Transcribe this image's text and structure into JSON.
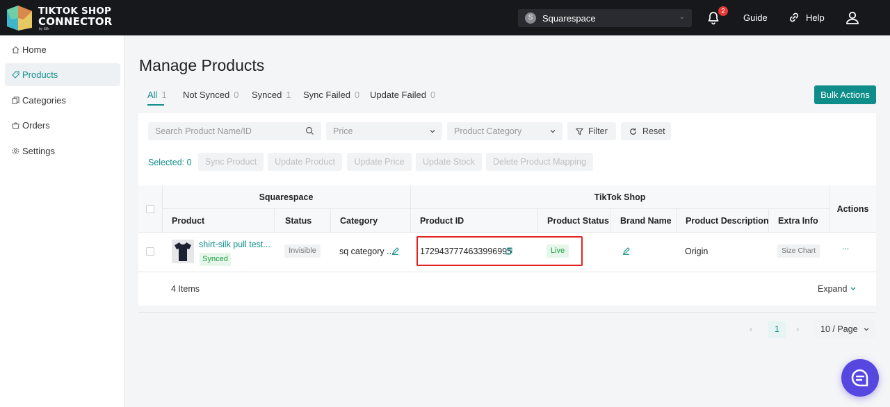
{
  "brand": {
    "line1": "TIKTOK SHOP",
    "line2": "CONNECTOR",
    "by": "by Silk"
  },
  "header": {
    "store": {
      "avatar": "S",
      "name": "Squarespace"
    },
    "notifications": "2",
    "guide": "Guide",
    "help": "Help",
    "icons": [
      "bell-icon",
      "help-icon",
      "user-icon"
    ]
  },
  "sidebar": {
    "items": [
      {
        "label": "Home",
        "icon": "home-icon",
        "active": false
      },
      {
        "label": "Products",
        "icon": "tag-icon",
        "active": true
      },
      {
        "label": "Categories",
        "icon": "copy-icon",
        "active": false
      },
      {
        "label": "Orders",
        "icon": "cart-icon",
        "active": false
      },
      {
        "label": "Settings",
        "icon": "gear-icon",
        "active": false
      }
    ]
  },
  "page": {
    "title": "Manage Products",
    "tabs": [
      {
        "label": "All",
        "count": "1"
      },
      {
        "label": "Not Synced",
        "count": "0"
      },
      {
        "label": "Synced",
        "count": "1"
      },
      {
        "label": "Sync Failed",
        "count": "0"
      },
      {
        "label": "Update Failed",
        "count": "0"
      }
    ],
    "bulk_actions": "Bulk Actions"
  },
  "filters": {
    "search_placeholder": "Search Product Name/ID",
    "price_placeholder": "Price",
    "category_placeholder": "Product Category",
    "filter": "Filter",
    "reset": "Reset"
  },
  "selection": {
    "selected": "Selected: 0",
    "actions": [
      "Sync Product",
      "Update Product",
      "Update Price",
      "Update Stock",
      "Delete Product Mapping"
    ]
  },
  "table": {
    "group_squarespace": "Squarespace",
    "group_tiktok": "TikTok Shop",
    "actions": "Actions",
    "columns": [
      "Product",
      "Status",
      "Category",
      "Product ID",
      "Product Status",
      "Brand Name",
      "Product Description",
      "Extra Info"
    ],
    "rows": [
      {
        "product": "shirt-silk pull test...",
        "sync_tag": "Synced",
        "status": "Invisible",
        "category": "sq category ...",
        "product_id": "1729437774633996995",
        "product_status": "Live",
        "description": "Origin",
        "extra_info": "Size Chart",
        "more": "···"
      }
    ],
    "items": "4 Items",
    "expand": "Expand"
  },
  "pagination": {
    "current": "1",
    "page_size": "10 / Page"
  },
  "colors": {
    "accent": "#0f8d8a",
    "topbar": "#17181c",
    "highlight": "#e52222",
    "chat": "#5547e0"
  }
}
